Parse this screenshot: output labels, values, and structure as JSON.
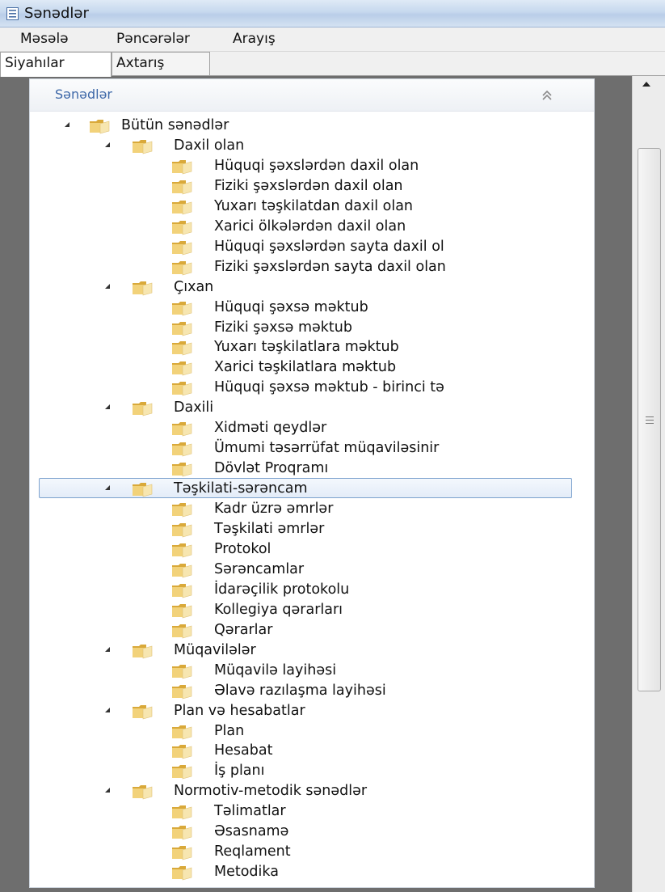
{
  "window": {
    "title": "Sənədlər",
    "icon": "document-list-icon"
  },
  "menu": [
    "Məsələ",
    "Pəncərələr",
    "Arayış"
  ],
  "tabs": [
    {
      "label": "Siyahılar",
      "active": true
    },
    {
      "label": "Axtarış",
      "active": false
    }
  ],
  "panel": {
    "title": "Sənədlər",
    "collapse_icon": "double-chevron-up-icon"
  },
  "tree": {
    "root": "Bütün sənədlər",
    "selected": "Təşkilati-sərəncam",
    "groups": [
      {
        "label": "Daxil olan",
        "children": [
          "Hüquqi şəxslərdən daxil olan",
          "Fiziki şəxslərdən daxil olan",
          "Yuxarı təşkilatdan daxil olan",
          "Xarici ölkələrdən daxil olan",
          "Hüquqi şəxslərdən sayta daxil ol",
          "Fiziki şəxslərdən sayta daxil olan"
        ]
      },
      {
        "label": "Çıxan",
        "children": [
          "Hüquqi şəxsə məktub",
          "Fiziki şəxsə məktub",
          "Yuxarı təşkilatlara məktub",
          "Xarici təşkilatlara məktub",
          "Hüquqi şəxsə məktub - birinci tə"
        ]
      },
      {
        "label": "Daxili",
        "children": [
          "Xidməti qeydlər",
          "Ümumi təsərrüfat müqaviləsinir",
          "Dövlət Proqramı"
        ]
      },
      {
        "label": "Təşkilati-sərəncam",
        "children": [
          "Kadr üzrə əmrlər",
          "Təşkilati əmrlər",
          "Protokol",
          "Sərəncamlar",
          "İdarəçilik protokolu",
          "Kollegiya qərarları",
          "Qərarlar"
        ]
      },
      {
        "label": "Müqavilələr",
        "children": [
          "Müqavilə layihəsi",
          "Əlavə razılaşma layihəsi"
        ]
      },
      {
        "label": "Plan və hesabatlar",
        "children": [
          "Plan",
          "Hesabat",
          "İş planı"
        ]
      },
      {
        "label": "Normotiv-metodik sənədlər",
        "children": [
          "Təlimatlar",
          "Əsasnamə",
          "Reqlament",
          "Metodika"
        ]
      }
    ]
  },
  "colors": {
    "panel_title": "#3d68a8",
    "selection_border": "#7da2ce",
    "workspace": "#6e6e6e",
    "folder": "#e9c45a"
  }
}
